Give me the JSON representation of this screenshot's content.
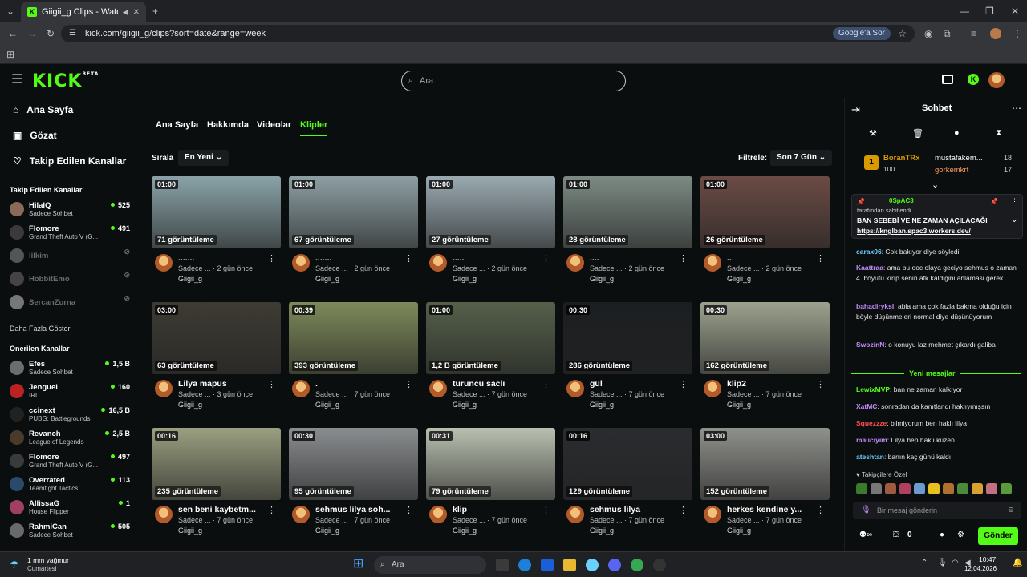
{
  "browser": {
    "tab_title": "Giigii_g Clips - Watch Live on Kick",
    "url": "kick.com/giigii_g/clips?sort=date&range=week",
    "google_chip": "Google'a Sor"
  },
  "header": {
    "logo": "KICK",
    "logo_beta": "BETA",
    "search_placeholder": "Ara"
  },
  "sidebar": {
    "nav": [
      {
        "label": "Ana Sayfa",
        "icon": "home-icon"
      },
      {
        "label": "Gözat",
        "icon": "browse-icon"
      },
      {
        "label": "Takip Edilen Kanallar",
        "icon": "heart-icon"
      }
    ],
    "followed_title": "Takip Edilen Kanallar",
    "followed": [
      {
        "name": "HilalQ",
        "sub": "Sadece Sohbet",
        "viewers": "525",
        "online": true,
        "color": "#8c6a5a"
      },
      {
        "name": "Flomore",
        "sub": "Grand Theft Auto V (G...",
        "viewers": "491",
        "online": true,
        "color": "#3a3a3a"
      },
      {
        "name": "lilkim",
        "sub": "",
        "viewers": "",
        "online": false,
        "color": "#555"
      },
      {
        "name": "HobbitEmo",
        "sub": "",
        "viewers": "",
        "online": false,
        "color": "#444"
      },
      {
        "name": "SercanZurna",
        "sub": "",
        "viewers": "",
        "online": false,
        "color": "#777"
      }
    ],
    "show_more": "Daha Fazla Göster",
    "recommended_title": "Önerilen Kanallar",
    "recommended": [
      {
        "name": "Efes",
        "sub": "Sadece Sohbet",
        "viewers": "1,5 B",
        "color": "#6d6d6d"
      },
      {
        "name": "Jenguel",
        "sub": "IRL",
        "viewers": "160",
        "color": "#b22"
      },
      {
        "name": "ccinext",
        "sub": "PUBG: Battlegrounds",
        "viewers": "16,5 B",
        "color": "#222"
      },
      {
        "name": "Revanch",
        "sub": "League of Legends",
        "viewers": "2,5 B",
        "color": "#4a3a2a"
      },
      {
        "name": "Flomore",
        "sub": "Grand Theft Auto V (G...",
        "viewers": "497",
        "color": "#3a3a3a"
      },
      {
        "name": "Overrated",
        "sub": "Teamfight Tactics",
        "viewers": "113",
        "color": "#2a4a6a"
      },
      {
        "name": "AllissaG",
        "sub": "House Flipper",
        "viewers": "1",
        "color": "#a04060"
      },
      {
        "name": "RahmiCan",
        "sub": "Sadece Sohbet",
        "viewers": "505",
        "color": "#6a6a6a"
      }
    ]
  },
  "main": {
    "tabs": [
      {
        "label": "Ana Sayfa",
        "active": false
      },
      {
        "label": "Hakkımda",
        "active": false
      },
      {
        "label": "Videolar",
        "active": false
      },
      {
        "label": "Klipler",
        "active": true
      }
    ],
    "sort_label": "Sırala",
    "sort_value": "En Yeni",
    "filter_label": "Filtrele:",
    "filter_value": "Son 7 Gün",
    "clips": [
      {
        "dur": "01:00",
        "views": "71 görüntüleme",
        "title": ".......",
        "sub": "Sadece ... · 2 gün önce",
        "channel": "Giigii_g",
        "bg": "#8aa3a8"
      },
      {
        "dur": "01:00",
        "views": "67 görüntüleme",
        "title": ".......",
        "sub": "Sadece ... · 2 gün önce",
        "channel": "Giigii_g",
        "bg": "#8d9fa3"
      },
      {
        "dur": "01:00",
        "views": "27 görüntüleme",
        "title": ".....",
        "sub": "Sadece ... · 2 gün önce",
        "channel": "Giigii_g",
        "bg": "#9aaab0"
      },
      {
        "dur": "01:00",
        "views": "28 görüntüleme",
        "title": "....",
        "sub": "Sadece ... · 2 gün önce",
        "channel": "Giigii_g",
        "bg": "#7c8a83"
      },
      {
        "dur": "01:00",
        "views": "26 görüntüleme",
        "title": "..",
        "sub": "Sadece ... · 2 gün önce",
        "channel": "Giigii_g",
        "bg": "#6b4b45"
      },
      {
        "dur": "03:00",
        "views": "63 görüntüleme",
        "title": "Lilya mapus",
        "sub": "Sadece ... · 3 gün önce",
        "channel": "Giigii_g",
        "bg": "#3d3b33"
      },
      {
        "dur": "00:39",
        "views": "393 görüntüleme",
        "title": ".",
        "sub": "Sadece ... · 7 gün önce",
        "channel": "Giigii_g",
        "bg": "#7d8a5a"
      },
      {
        "dur": "01:00",
        "views": "1,2 B görüntüleme",
        "title": "turuncu saclı",
        "sub": "Sadece ... · 7 gün önce",
        "channel": "Giigii_g",
        "bg": "#55604a"
      },
      {
        "dur": "00:30",
        "views": "286 görüntüleme",
        "title": "gül",
        "sub": "Sadece ... · 7 gün önce",
        "channel": "Giigii_g",
        "bg": "#1c1f22"
      },
      {
        "dur": "00:30",
        "views": "162 görüntüleme",
        "title": "klip2",
        "sub": "Sadece ... · 7 gün önce",
        "channel": "Giigii_g",
        "bg": "#9ca28e"
      },
      {
        "dur": "00:16",
        "views": "235 görüntüleme",
        "title": "sen beni kaybetm...",
        "sub": "Sadece ... · 7 gün önce",
        "channel": "Giigii_g",
        "bg": "#9aa080"
      },
      {
        "dur": "00:30",
        "views": "95 görüntüleme",
        "title": "sehmus lilya soh...",
        "sub": "Sadece ... · 7 gün önce",
        "channel": "Giigii_g",
        "bg": "#8a8d8f"
      },
      {
        "dur": "00:31",
        "views": "79 görüntüleme",
        "title": "klip",
        "sub": "Sadece ... · 7 gün önce",
        "channel": "Giigii_g",
        "bg": "#b9c0b0"
      },
      {
        "dur": "00:16",
        "views": "129 görüntüleme",
        "title": "sehmus lilya",
        "sub": "Sadece ... · 7 gün önce",
        "channel": "Giigii_g",
        "bg": "#2a2c2f"
      },
      {
        "dur": "03:00",
        "views": "152 görüntüleme",
        "title": "herkes kendine y...",
        "sub": "Sadece ... · 7 gün önce",
        "channel": "Giigii_g",
        "bg": "#8f918c"
      }
    ]
  },
  "chat": {
    "title": "Sohbet",
    "leader_rank": "1",
    "leader_name": "BoranTRx",
    "leader_amount": "100",
    "leader2_name": "mustafakem...",
    "leader2_amount": "18",
    "leader3_name": "gorkemkrt",
    "leader3_amount": "17",
    "pinned_user": "0SpAC3",
    "pinned_by": "tarafından sabitlendi",
    "pinned_text": "BAN SEBEBİ VE NE ZAMAN AÇILACAĞI",
    "pinned_link": "https://knglban.spac3.workers.dev/",
    "messages": [
      {
        "user": "carax06",
        "color": "#6ad1ff",
        "text": ": Cok bakıyor diye söyledi"
      },
      {
        "user": "Kaattraa",
        "color": "#c48cff",
        "text": ": ama bu ooc olaya geciyo sehmus o zaman 4. boyutu kırıp senin afk kaldigini anlamasi gerek"
      },
      {
        "user": "bahadiryksl",
        "color": "#c48cff",
        "text": ": abla ama çok fazla bakma olduğu için böyle düşünmeleri normal diye düşünüyorum"
      },
      {
        "user": "SwozinN",
        "color": "#c48cff",
        "text": ": o konuyu laz mehmet çıkardı galiba"
      }
    ],
    "new_messages_label": "Yeni mesajlar",
    "new_messages": [
      {
        "user": "LewixMVP",
        "color": "#53fc18",
        "text": ": ban ne zaman kalkıyor"
      },
      {
        "user": "XatMC",
        "color": "#c48cff",
        "text": ": sonradan da kanıtlandı haklıymışsın"
      },
      {
        "user": "Squezzze",
        "color": "#ff4d4d",
        "text": ": bilmiyorum ben haklı lilya"
      },
      {
        "user": "maliciyim",
        "color": "#c48cff",
        "text": ": Lilya hep haklı kuzen"
      },
      {
        "user": "ateshtan",
        "color": "#6ad1ff",
        "text": ": banın kaç günü kaldı"
      }
    ],
    "followers_only": "Takipçilere Özel",
    "input_placeholder": "Bir mesaj gönderin",
    "points": "0",
    "send_label": "Gönder"
  },
  "taskbar": {
    "weather": "1 mm yağmur",
    "weather_day": "Cumartesi",
    "search": "Ara",
    "time": "10:47",
    "date": "12.04.2026"
  }
}
